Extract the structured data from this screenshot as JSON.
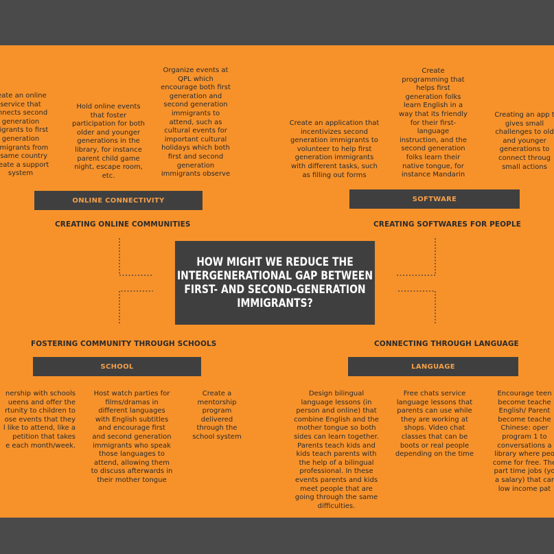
{
  "center": {
    "question": "HOW MIGHT WE REDUCE THE INTERGENERATIONAL GAP BETWEEN FIRST- AND SECOND-GENERATION IMMIGRANTS?"
  },
  "online": {
    "box": "ONLINE CONNECTIVITY",
    "label": "CREATING ONLINE COMMUNITIES",
    "notes": [
      "reate an online\nservice that\nonnects second\ngeneration\nmigrants to first\ngeneration\nmmigrants from\ne same country\ncreate a support\nsystem",
      "Hold online events\nthat foster\nparticipation for both\nolder and younger\ngenerations in the\nlibrary, for instance\nparent child game\nnight, escape room,\netc.",
      "Organize events at\nQPL which\nencourage both first\ngeneration and\nsecond generation\nimmigrants to\nattend, such as\ncultural events for\nimportant cultural\nholidays which both\nfirst and second\ngeneration\nimmigrants observe"
    ]
  },
  "software": {
    "box": "SOFTWARE",
    "label": "CREATING SOFTWARES FOR PEOPLE",
    "notes": [
      "Create an application that\nincentivizes second\ngeneration immigrants to\nvolunteer to help first\ngeneration immigrants\nwith different tasks, such\nas filling out forms",
      "Create\nprogramming that\nhelps first\ngeneration folks\nlearn English in a\nway that its friendly\nfor their first-\nlanguage\ninstruction, and the\nsecond generation\nfolks learn their\nnative tongue, for\ninstance Mandarin",
      "Creating an app t\ngives small\nchallenges to old\nand younger\ngenerations to\nconnect throug\nsmall actions"
    ]
  },
  "school": {
    "box": "SCHOOL",
    "label": "FOSTERING COMMUNITY THROUGH SCHOOLS",
    "notes": [
      "nership with schools\nueens and offer the\nrtunity to children to\nose events that they\nl like to attend, like a\npetition that takes\ne each month/week.",
      "Host watch parties for\nfilms/dramas in\ndifferent languages\nwith English subtitles\nand encourage first\nand second generation\nimmigrants who speak\nthose languages to\nattend, allowing them\nto discuss afterwards in\ntheir mother tongue",
      "Create a\nmentorship\nprogram\ndelivered\nthrough the\nschool system"
    ]
  },
  "language": {
    "box": "LANGUAGE",
    "label": "CONNECTING THROUGH LANGUAGE",
    "notes": [
      "Design bilingual\nlanguage lessons (in\nperson and online) that\ncombine English and the\nmother tongue so both\nsides can learn together.\nParents teach kids and\nkids teach parents with\nthe help of a bilingual\nprofessional. In these\nevents parents and kids\nmeet people that are\ngoing through the same\ndifficulties.",
      "Free chats service\nlanguage lessons that\nparents can use while\nthey are working at\nshops. Video chat\nclasses that can be\nboots or real people\ndepending on the time",
      "Encourage teen\nbecome teache\nEnglish/ Parent\nbecome teache\nChinese: oper\nprogram 1 to\nconversations a\nlibrary where peo\ncome for free. The\npart time jobs (yo\na salary) that car\nlow income pat"
    ]
  }
}
